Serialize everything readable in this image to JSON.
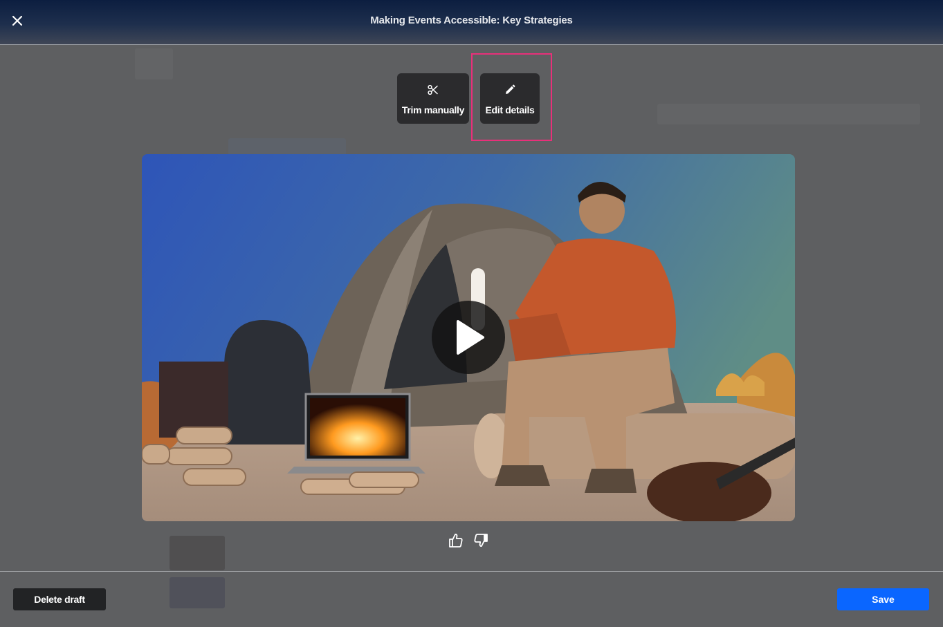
{
  "header": {
    "title": "Making Events Accessible: Key Strategies",
    "close_icon": "close-icon"
  },
  "toolbar": {
    "trim_label": "Trim manually",
    "trim_icon": "scissors-icon",
    "edit_label": "Edit details",
    "edit_icon": "pencil-icon"
  },
  "video": {
    "play_icon": "play-icon"
  },
  "feedback": {
    "like_icon": "thumbs-up-icon",
    "dislike_icon": "thumbs-down-icon"
  },
  "footer": {
    "delete_label": "Delete draft",
    "save_label": "Save"
  },
  "colors": {
    "accent": "#0a66ff",
    "highlight": "#e8307a",
    "overlay": "#5e5f61"
  }
}
